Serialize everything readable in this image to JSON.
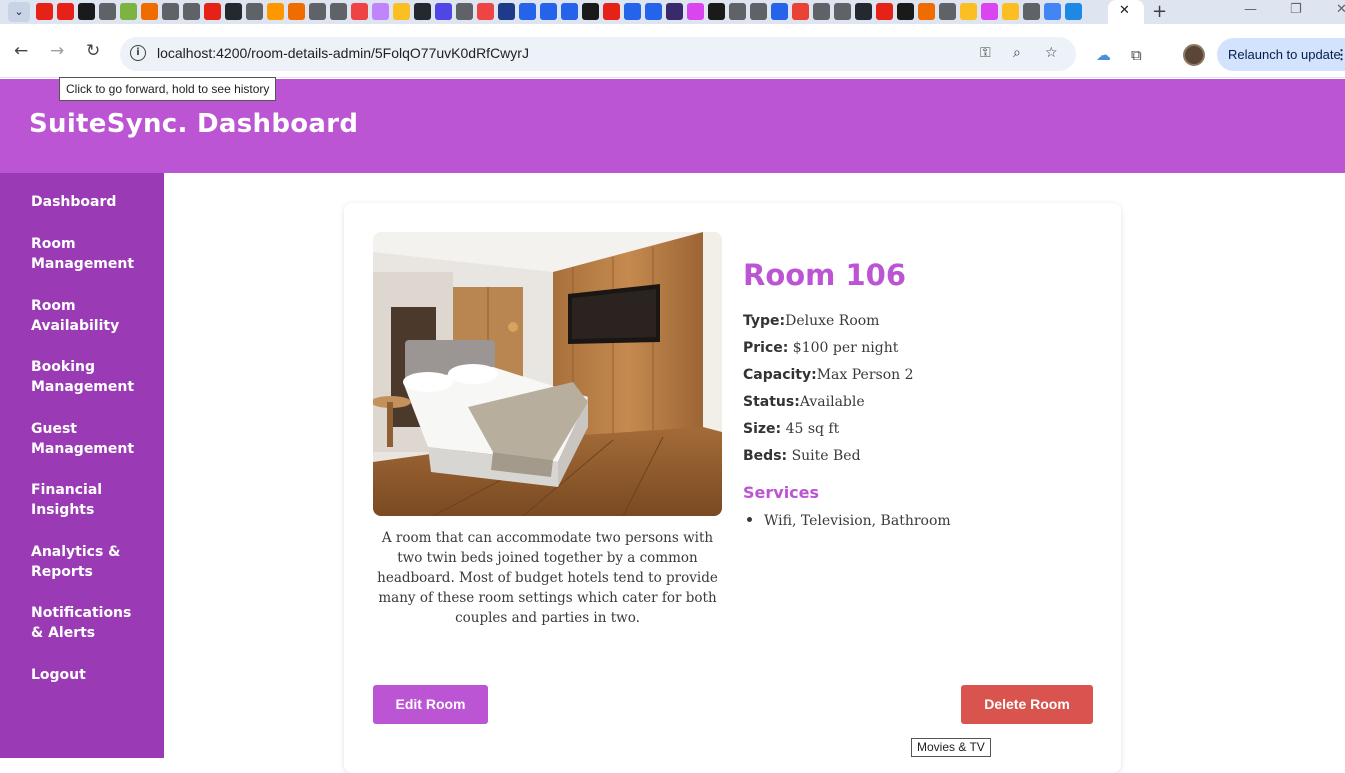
{
  "browser": {
    "url": "localhost:4200/room-details-admin/5FolqO77uvK0dRfCwyrJ",
    "relaunch_label": "Relaunch to update",
    "forward_tooltip": "Click to go forward, hold to see history",
    "hover_tooltip": "Movies & TV",
    "favicon_colors": [
      "#e62117",
      "#e62117",
      "#1a1a1a",
      "#5f6368",
      "#7cb342",
      "#ef6c00",
      "#5f6368",
      "#5f6368",
      "#e62117",
      "#24292f",
      "#5f6368",
      "#ff9800",
      "#ef6c00",
      "#5f6368",
      "#5f6368",
      "#ef4444",
      "#c084fc",
      "#fbbf24",
      "#24292f",
      "#4f46e5",
      "#5f6368",
      "#ef4444",
      "#1e3a8a",
      "#2563eb",
      "#2563eb",
      "#2563eb",
      "#1a1a1a",
      "#e62117",
      "#2563eb",
      "#2563eb",
      "#3b2a6b",
      "#d946ef",
      "#1a1a1a",
      "#5f6368",
      "#5f6368",
      "#2563eb",
      "#ea4335",
      "#5f6368",
      "#5f6368",
      "#24292f",
      "#e62117",
      "#1a1a1a",
      "#ef6c00",
      "#5f6368",
      "#fbbf24",
      "#d946ef",
      "#fbbf24",
      "#5f6368",
      "#4285f4",
      "#1e88e5"
    ]
  },
  "app": {
    "title": "SuiteSync. Dashboard",
    "colors": {
      "header": "#bb55d4",
      "sidebar": "#9a3bb5",
      "accent": "#bb55d4",
      "danger": "#d9534f"
    }
  },
  "sidebar": {
    "items": [
      {
        "label": "Dashboard"
      },
      {
        "label": "Room Management"
      },
      {
        "label": "Room Availability"
      },
      {
        "label": "Booking Management"
      },
      {
        "label": "Guest Management"
      },
      {
        "label": "Financial Insights"
      },
      {
        "label": "Analytics & Reports"
      },
      {
        "label": "Notifications & Alerts"
      },
      {
        "label": "Logout"
      }
    ]
  },
  "room": {
    "title": "Room 106",
    "description": "A room that can accommodate two persons with two twin beds joined together by a common headboard. Most of budget hotels tend to provide many of these room settings which cater for both couples and parties in two.",
    "specs": [
      {
        "label": "Type:",
        "value": "Deluxe Room"
      },
      {
        "label": "Price:",
        "value": " $100 per night"
      },
      {
        "label": "Capacity:",
        "value": "Max Person 2"
      },
      {
        "label": "Status:",
        "value": "Available"
      },
      {
        "label": "Size:",
        "value": " 45 sq ft"
      },
      {
        "label": "Beds:",
        "value": " Suite Bed"
      }
    ],
    "services_title": "Services",
    "services": [
      "Wifi, Television, Bathroom"
    ]
  },
  "actions": {
    "edit_label": "Edit Room",
    "delete_label": "Delete Room"
  }
}
